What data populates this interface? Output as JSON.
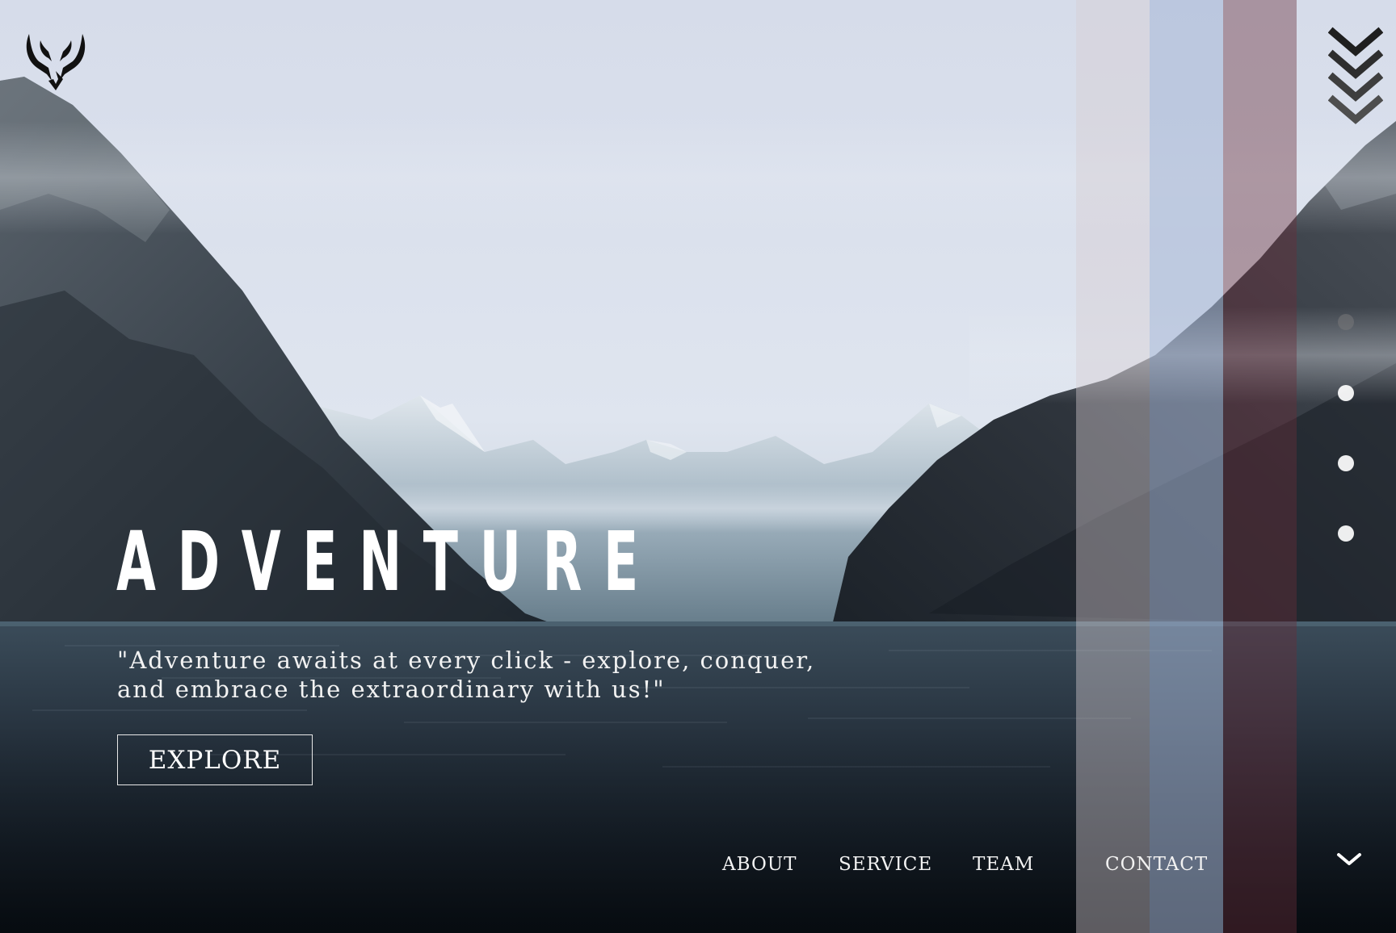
{
  "hero": {
    "headline": "ADVENTURE",
    "tagline": "\"Adventure awaits at every click - explore, conquer, and embrace the extraordinary with us!\"",
    "cta_label": "EXPLORE"
  },
  "nav": {
    "items": [
      {
        "label": "ABOUT"
      },
      {
        "label": "SERVICE"
      },
      {
        "label": "TEAM"
      },
      {
        "label": "CONTACT"
      }
    ]
  },
  "slider": {
    "count": 4,
    "active_index": 0
  },
  "icons": {
    "logo": "winged-emblem-logo",
    "menu": "chevrons-menu-icon",
    "scroll": "chevron-down-icon"
  },
  "colors": {
    "accent_bar_1": "#d6ced2",
    "accent_bar_2": "#a6b6d6",
    "accent_bar_3": "#682e3a",
    "text": "#ffffff"
  }
}
